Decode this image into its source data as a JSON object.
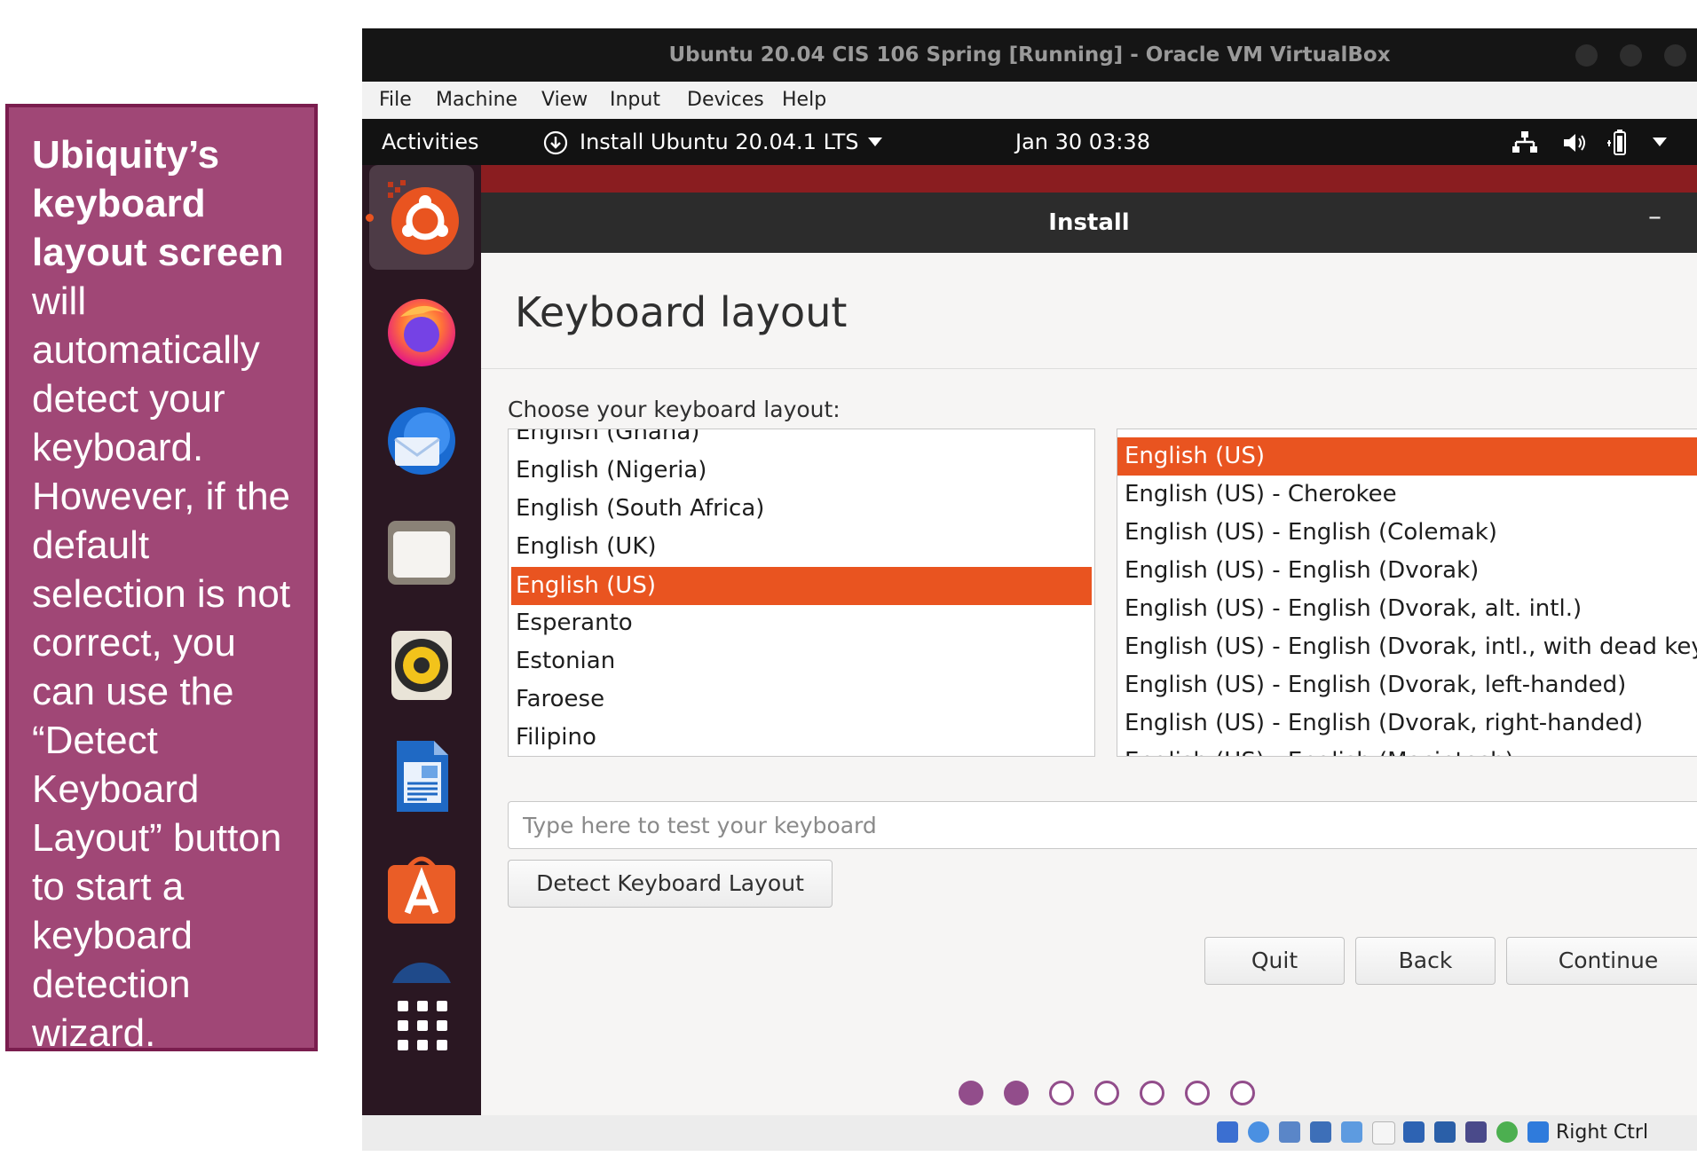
{
  "callout": {
    "bold_text": "Ubiquity’s keyboard layout screen",
    "text": "will automatically detect your keyboard. However, if the default selection is not correct, you can use the “Detect Keyboard Layout” button to start a keyboard detection wizard."
  },
  "vm_window": {
    "title": "Ubuntu 20.04 CIS 106 Spring [Running] - Oracle VM VirtualBox",
    "menu": [
      "File",
      "Machine",
      "View",
      "Input",
      "Devices",
      "Help"
    ]
  },
  "gnome_topbar": {
    "activities": "Activities",
    "app_menu": "Install Ubuntu 20.04.1 LTS",
    "clock": "Jan 30  03:38"
  },
  "dock": {
    "icons": [
      "ubuntu-installer-icon",
      "firefox-icon",
      "thunderbird-icon",
      "files-icon",
      "rhythmbox-icon",
      "libreoffice-writer-icon",
      "software-center-icon",
      "help-icon",
      "show-apps-icon"
    ]
  },
  "installer": {
    "window_title": "Install",
    "minimize": "–",
    "heading": "Keyboard layout",
    "choose_label": "Choose your keyboard layout:",
    "layouts": [
      "English (Ghana)",
      "English (Nigeria)",
      "English (South Africa)",
      "English (UK)",
      "English (US)",
      "Esperanto",
      "Estonian",
      "Faroese",
      "Filipino"
    ],
    "selected_layout": "English (US)",
    "variants": [
      "English (US)",
      "English (US) - Cherokee",
      "English (US) - English (Colemak)",
      "English (US) - English (Dvorak)",
      "English (US) - English (Dvorak, alt. intl.)",
      "English (US) - English (Dvorak, intl., with dead keys)",
      "English (US) - English (Dvorak, left-handed)",
      "English (US) - English (Dvorak, right-handed)",
      "English (US) - English (Macintosh)"
    ],
    "selected_variant": "English (US)",
    "test_placeholder": "Type here to test your keyboard",
    "detect_button": "Detect Keyboard Layout",
    "quit_button": "Quit",
    "back_button": "Back",
    "continue_button": "Continue",
    "progress": {
      "current_step": 2,
      "total_steps": 7
    }
  },
  "statusbar": {
    "host_key": "Right Ctrl"
  },
  "colors": {
    "accent": "#e95420",
    "progress": "#924d8b",
    "callout_bg": "#a04776",
    "desktop": "#8a1d20",
    "dock": "#2a1722"
  }
}
